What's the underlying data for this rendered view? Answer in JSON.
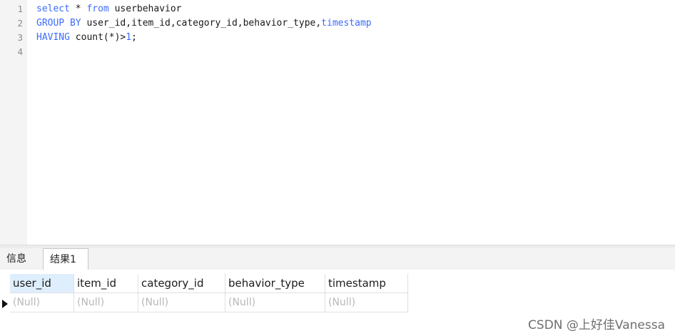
{
  "editor": {
    "line_numbers": [
      "1",
      "2",
      "3",
      "4"
    ],
    "line1": {
      "k1": "select",
      "t1": " * ",
      "k2": "from",
      "t2": " userbehavior"
    },
    "line2": {
      "k1": "GROUP BY",
      "t1": " user_id,item_id,category_id,behavior_type,",
      "k2": "timestamp"
    },
    "line3": {
      "k1": "HAVING",
      "t1": " count(*)>",
      "n1": "1",
      "t2": ";"
    }
  },
  "tabs": [
    {
      "label": "信息"
    },
    {
      "label": "结果1"
    }
  ],
  "grid": {
    "columns": [
      "user_id",
      "item_id",
      "category_id",
      "behavior_type",
      "timestamp"
    ],
    "rows": [
      [
        "(Null)",
        "(Null)",
        "(Null)",
        "(Null)",
        "(Null)"
      ]
    ]
  },
  "watermark": "CSDN @上好佳Vanessa",
  "colors": {
    "keyword": "#3b6cff",
    "selected_header": "#dfeefd",
    "null_text": "#b8b8b8"
  }
}
